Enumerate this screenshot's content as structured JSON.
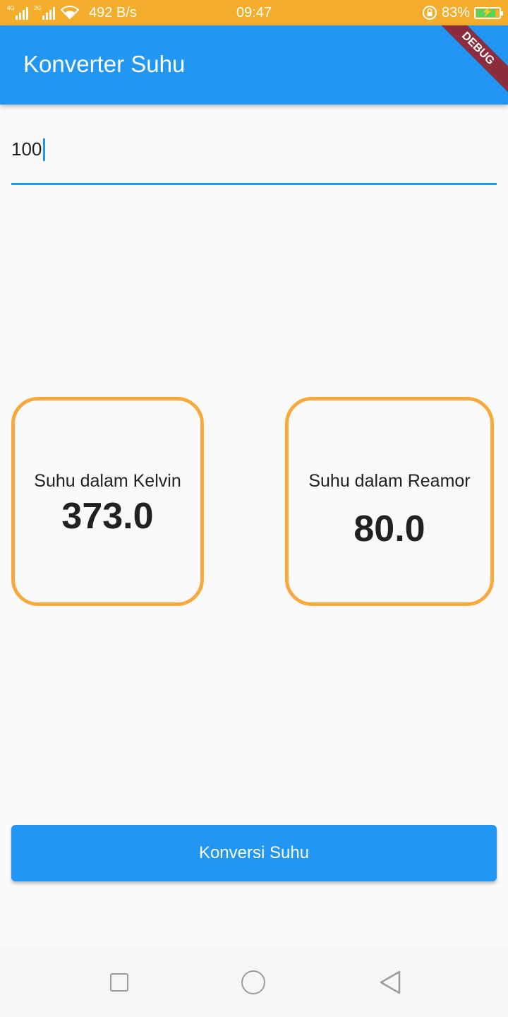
{
  "status_bar": {
    "net1": "4G",
    "net2": "2G",
    "speed": "492 B/s",
    "time": "09:47",
    "battery_percent": "83%",
    "battery_level": 0.83
  },
  "app_bar": {
    "title": "Konverter Suhu",
    "debug_label": "DEBUG"
  },
  "input": {
    "value": "100"
  },
  "cards": [
    {
      "label": "Suhu dalam Kelvin",
      "value": "373.0"
    },
    {
      "label": "Suhu dalam Reamor",
      "value": "80.0"
    }
  ],
  "button": {
    "label": "Konversi Suhu"
  },
  "colors": {
    "primary": "#2196f3",
    "status_bar": "#f4ad2a",
    "card_border": "#f9a93b",
    "debug_banner": "#8a2c3c"
  },
  "nav_icons": [
    "recents-square-icon",
    "home-circle-icon",
    "back-triangle-icon"
  ]
}
